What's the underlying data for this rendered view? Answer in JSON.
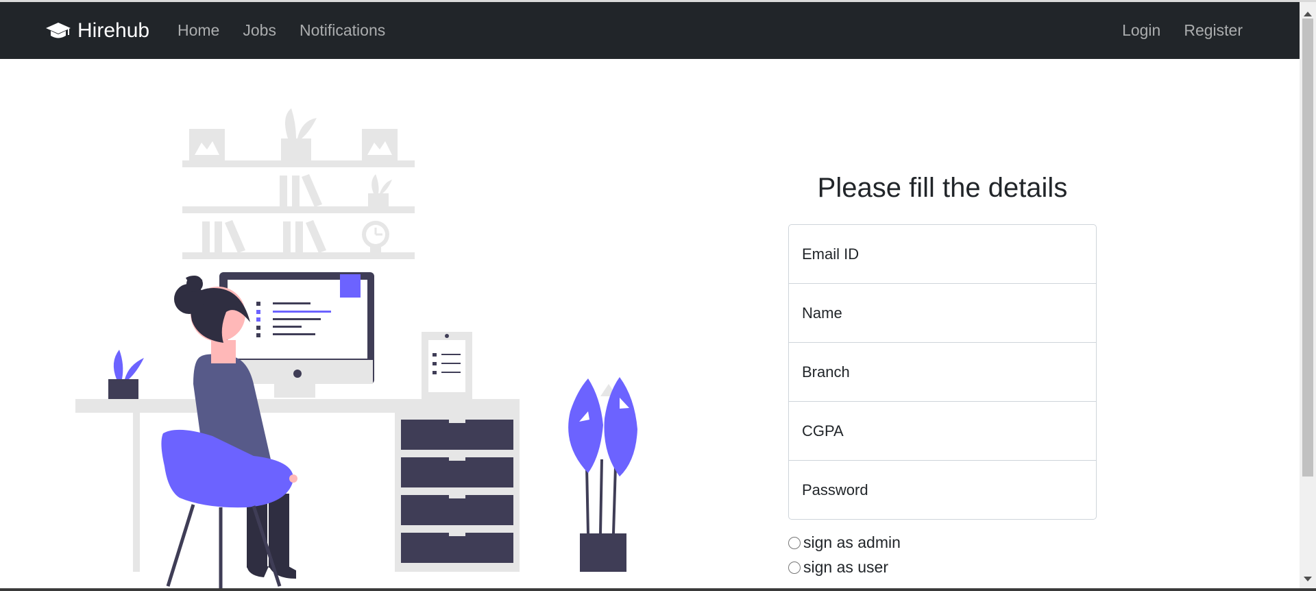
{
  "navbar": {
    "brand": "Hirehub",
    "brand_icon": "graduation-cap-icon",
    "links": [
      "Home",
      "Jobs",
      "Notifications"
    ],
    "right_links": [
      "Login",
      "Register"
    ]
  },
  "form": {
    "title": "Please fill the details",
    "fields": [
      {
        "placeholder": "Email ID",
        "value": ""
      },
      {
        "placeholder": "Name",
        "value": ""
      },
      {
        "placeholder": "Branch",
        "value": ""
      },
      {
        "placeholder": "CGPA",
        "value": ""
      },
      {
        "placeholder": "Password",
        "value": ""
      }
    ],
    "radios": [
      {
        "label": "sign as admin",
        "checked": false
      },
      {
        "label": "sign as user",
        "checked": false
      }
    ]
  },
  "colors": {
    "navbar": "#212529",
    "accent": "#6c63ff",
    "dark": "#3f3d56"
  }
}
